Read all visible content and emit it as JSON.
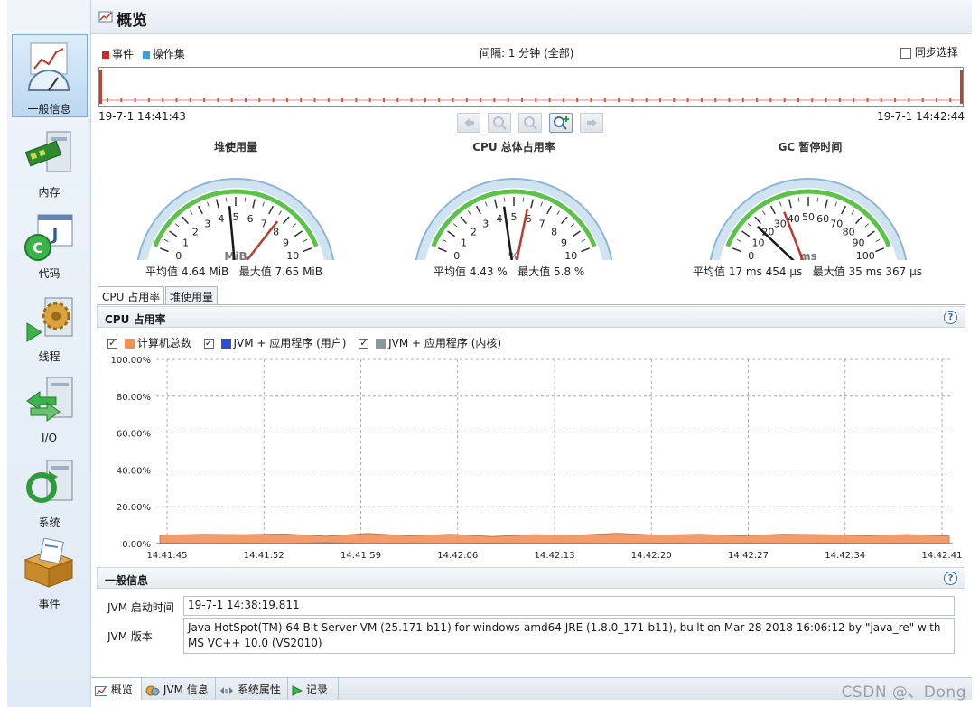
{
  "header": {
    "title": "概览",
    "icon": "overview-icon"
  },
  "sidebar": {
    "items": [
      {
        "label": "一般信息",
        "icon": "gauge-chart-icon"
      },
      {
        "label": "内存",
        "icon": "memory-chip-icon"
      },
      {
        "label": "代码",
        "icon": "code-java-icon"
      },
      {
        "label": "线程",
        "icon": "threads-gear-icon"
      },
      {
        "label": "I/O",
        "icon": "io-arrows-icon"
      },
      {
        "label": "系统",
        "icon": "system-refresh-icon"
      },
      {
        "label": "事件",
        "icon": "events-box-icon"
      }
    ]
  },
  "timeline": {
    "legend_event": "事件",
    "legend_opset": "操作集",
    "interval": "间隔: 1 分钟 (全部)",
    "sync_label": "同步选择",
    "start_time": "19-7-1 14:41:43",
    "end_time": "19-7-1 14:42:44"
  },
  "gauges": [
    {
      "title": "堆使用量",
      "unit": "MiB",
      "ticks": [
        "0",
        "1",
        "2",
        "3",
        "4",
        "5",
        "6",
        "7",
        "8",
        "9",
        "10"
      ],
      "min": 0,
      "max": 10,
      "avg": 4.64,
      "peak": 7.65,
      "stats_avg": "平均值 4.64 MiB",
      "stats_max": "最大值 7.65 MiB"
    },
    {
      "title": "CPU 总体占用率",
      "unit": "%",
      "ticks": [
        "0",
        "1",
        "2",
        "3",
        "4",
        "5",
        "6",
        "7",
        "8",
        "9",
        "10"
      ],
      "min": 0,
      "max": 10,
      "avg": 4.43,
      "peak": 5.8,
      "stats_avg": "平均值 4.43 %",
      "stats_max": "最大值 5.8 %"
    },
    {
      "title": "GC 暂停时间",
      "unit": "ms",
      "ticks": [
        "0",
        "10",
        "20",
        "30",
        "40",
        "50",
        "60",
        "70",
        "80",
        "90",
        "100"
      ],
      "min": 0,
      "max": 100,
      "avg": 17.454,
      "peak": 35.367,
      "stats_avg": "平均值 17 ms 454 μs",
      "stats_max": "最大值 35 ms 367 μs"
    }
  ],
  "tabs": {
    "cpu": "CPU 占用率",
    "heap": "堆使用量"
  },
  "cpu_section": {
    "title": "CPU 占用率",
    "legend": [
      {
        "name": "计算机总数",
        "color": "#f0915a"
      },
      {
        "name": "JVM + 应用程序 (用户)",
        "color": "#2f4fd0"
      },
      {
        "name": "JVM + 应用程序 (内核)",
        "color": "#8a9a9a"
      }
    ]
  },
  "chart_data": {
    "type": "area",
    "title": "CPU 占用率",
    "xlabel": "",
    "ylabel": "",
    "x": [
      "14:41:45",
      "14:41:52",
      "14:41:59",
      "14:42:06",
      "14:42:13",
      "14:42:20",
      "14:42:27",
      "14:42:34",
      "14:42:41"
    ],
    "ylim": [
      0,
      100
    ],
    "yticks": [
      "0.00%",
      "20.00%",
      "40.00%",
      "60.00%",
      "80.00%",
      "100.00%"
    ],
    "grid": true,
    "legend_placement": "top-left",
    "series": [
      {
        "name": "计算机总数",
        "color": "#f0915a",
        "values": [
          4.5,
          5.0,
          4.8,
          5.2,
          4.0,
          5.5,
          4.2,
          5.0,
          3.8,
          4.8,
          4.5,
          5.6,
          4.6,
          5.0,
          4.2,
          5.1,
          4.8,
          4.3,
          4.9,
          4.1
        ]
      },
      {
        "name": "JVM + 应用程序 (用户)",
        "color": "#2f4fd0",
        "values": [
          0.3,
          0.2,
          0.3,
          0.2,
          0.4,
          0.2,
          0.3,
          0.2,
          0.3,
          0.2,
          0.3,
          0.2,
          0.3,
          0.2,
          0.3,
          0.2,
          0.3,
          0.2,
          0.3,
          0.2
        ]
      },
      {
        "name": "JVM + 应用程序 (内核)",
        "color": "#8a9a9a",
        "values": [
          0.1,
          0.1,
          0.2,
          0.1,
          0.1,
          0.1,
          0.2,
          0.1,
          0.1,
          0.1,
          0.2,
          0.1,
          0.1,
          0.1,
          0.2,
          0.1,
          0.1,
          0.1,
          0.2,
          0.1
        ]
      }
    ]
  },
  "general_info": {
    "title": "一般信息",
    "jvm_start_label": "JVM 启动时间",
    "jvm_start_value": "19-7-1 14:38:19.811",
    "jvm_version_label": "JVM 版本",
    "jvm_version_value": "Java HotSpot(TM) 64-Bit Server VM (25.171-b11) for windows-amd64 JRE (1.8.0_171-b11), built on Mar 28 2018 16:06:12 by \"java_re\" with MS VC++ 10.0 (VS2010)"
  },
  "bottom_tabs": [
    {
      "label": "概览",
      "icon": "overview-icon"
    },
    {
      "label": "JVM 信息",
      "icon": "jvm-info-icon"
    },
    {
      "label": "系统属性",
      "icon": "properties-icon"
    },
    {
      "label": "记录",
      "icon": "play-record-icon"
    }
  ],
  "watermark": "CSDN @、Dong",
  "help_symbol": "?"
}
